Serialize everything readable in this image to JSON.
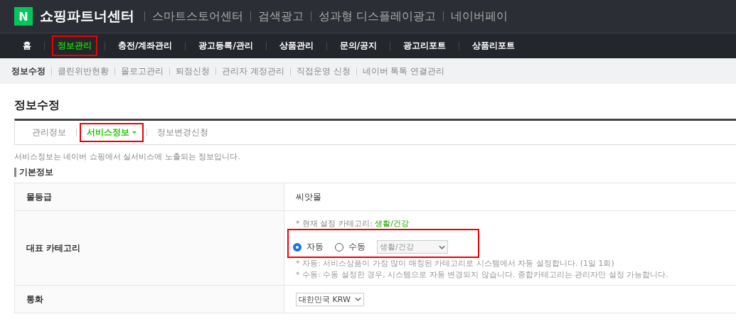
{
  "header": {
    "logo_letter": "N",
    "title": "쇼핑파트너센터",
    "links": [
      "스마트스토어센터",
      "검색광고",
      "성과형 디스플레이광고",
      "네이버페이"
    ]
  },
  "main_nav": [
    {
      "label": "홈",
      "selected": false,
      "highlighted": false
    },
    {
      "label": "정보관리",
      "selected": true,
      "highlighted": true
    },
    {
      "label": "충전/계좌관리",
      "selected": false,
      "highlighted": false
    },
    {
      "label": "광고등록/관리",
      "selected": false,
      "highlighted": false
    },
    {
      "label": "상품관리",
      "selected": false,
      "highlighted": false
    },
    {
      "label": "문의/공지",
      "selected": false,
      "highlighted": false
    },
    {
      "label": "광고리포트",
      "selected": false,
      "highlighted": false
    },
    {
      "label": "상품리포트",
      "selected": false,
      "highlighted": false
    }
  ],
  "sub_nav": [
    {
      "label": "정보수정",
      "selected": true
    },
    {
      "label": "클린위반현황",
      "selected": false
    },
    {
      "label": "몰로고관리",
      "selected": false
    },
    {
      "label": "퇴점신청",
      "selected": false
    },
    {
      "label": "관리자 계정관리",
      "selected": false
    },
    {
      "label": "직접운영 신청",
      "selected": false
    },
    {
      "label": "네이버 톡톡 연결관리",
      "selected": false
    }
  ],
  "page_title": "정보수정",
  "tabs": [
    {
      "label": "관리정보",
      "selected": false,
      "highlighted": false
    },
    {
      "label": "서비스정보",
      "selected": true,
      "highlighted": true
    },
    {
      "label": "정보변경신청",
      "selected": false,
      "highlighted": false
    }
  ],
  "notice": "서비스정보는 네이버 쇼핑에서 실서비스에 노출되는 정보입니다.",
  "section_title": "기본정보",
  "rows": [
    {
      "kind": "text",
      "label": "몰등급",
      "value": "씨앗몰"
    },
    {
      "kind": "category",
      "label": "대표 카테고리",
      "current_prefix": "* 현재 설정 카테고리: ",
      "current": "생활/건강",
      "highlighted": true,
      "options": [
        {
          "label": "자동",
          "selected": true
        },
        {
          "label": "수동",
          "selected": false
        }
      ],
      "select": "생활/건강",
      "select_disabled": true,
      "notes": [
        "* 자동: 서비스상품이 가장 많이 매칭된 카테고리로 시스템에서 자동 설정합니다. (1일 1회)",
        "* 수동: 수동 설정한 경우, 시스템으로 자동 변경되지 않습니다. 종합카테고리는 관리자만 설정 가능합니다."
      ]
    },
    {
      "kind": "select",
      "label": "통화",
      "select": "대한민국 KRW"
    }
  ]
}
